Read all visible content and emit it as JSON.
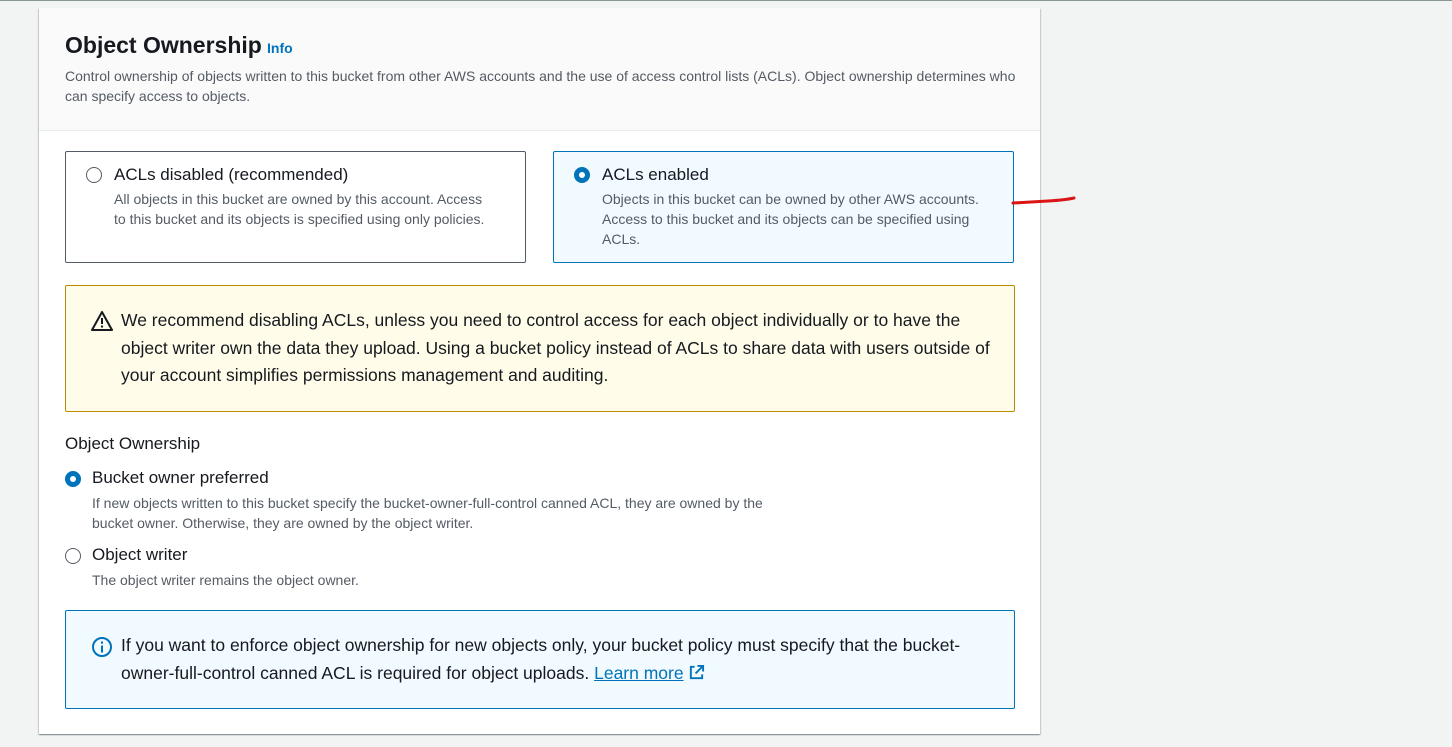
{
  "section": {
    "title": "Object Ownership",
    "info_link": "Info",
    "description": "Control ownership of objects written to this bucket from other AWS accounts and the use of access control lists (ACLs). Object ownership determines who can specify access to objects."
  },
  "acl_tiles": [
    {
      "label": "ACLs disabled (recommended)",
      "description": "All objects in this bucket are owned by this account. Access to this bucket and its objects is specified using only policies.",
      "selected": false
    },
    {
      "label": "ACLs enabled",
      "description": "Objects in this bucket can be owned by other AWS accounts. Access to this bucket and its objects can be specified using ACLs.",
      "selected": true
    }
  ],
  "warning_alert": {
    "icon": "warning-triangle-icon",
    "text": "We recommend disabling ACLs, unless you need to control access for each object individually or to have the object writer own the data they upload. Using a bucket policy instead of ACLs to share data with users outside of your account simplifies permissions management and auditing."
  },
  "ownership_field": {
    "label": "Object Ownership",
    "options": [
      {
        "label": "Bucket owner preferred",
        "description": "If new objects written to this bucket specify the bucket-owner-full-control canned ACL, they are owned by the bucket owner. Otherwise, they are owned by the object writer.",
        "selected": true
      },
      {
        "label": "Object writer",
        "description": "The object writer remains the object owner.",
        "selected": false
      }
    ]
  },
  "info_alert": {
    "icon": "info-circle-icon",
    "text": "If you want to enforce object ownership for new objects only, your bucket policy must specify that the bucket-owner-full-control canned ACL is required for object uploads.",
    "link_label": "Learn more",
    "link_icon": "external-link-icon"
  },
  "colors": {
    "accent": "#0073bb",
    "warning_border": "#ba8d00",
    "warning_bg": "#fffce9",
    "info_bg": "#f1faff",
    "annotation": "#d91515"
  }
}
